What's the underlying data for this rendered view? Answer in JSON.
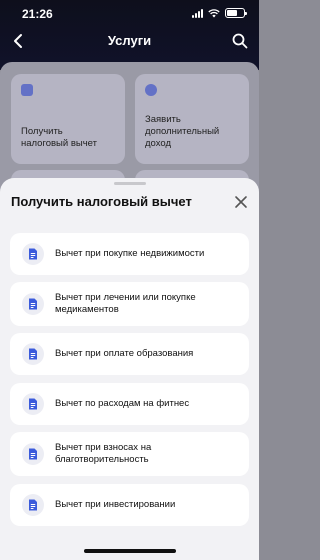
{
  "status": {
    "time": "21:26"
  },
  "navbar": {
    "title": "Услуги",
    "back_icon": "chevron-left-icon",
    "search_icon": "search-icon"
  },
  "services": [
    {
      "label": "Получить налоговый вычет",
      "icon": "calculator-icon"
    },
    {
      "label": "Заявить дополнительный доход",
      "icon": "ruble-icon"
    }
  ],
  "sheet": {
    "title": "Получить налоговый вычет",
    "options": [
      {
        "label": "Вычет при покупке недвижимости",
        "icon": "document-icon"
      },
      {
        "label": "Вычет при лечении или покупке медикаментов",
        "icon": "document-icon"
      },
      {
        "label": "Вычет при оплате образования",
        "icon": "document-icon"
      },
      {
        "label": "Вычет по расходам на фитнес",
        "icon": "document-icon"
      },
      {
        "label": "Вычет при взносах на благотворительность",
        "icon": "document-icon"
      },
      {
        "label": "Вычет при инвестировании",
        "icon": "document-icon"
      }
    ]
  },
  "colors": {
    "accent": "#3b5bdb",
    "sheet_bg": "#f2f2f5",
    "header_bg": "#0e0f1c"
  }
}
